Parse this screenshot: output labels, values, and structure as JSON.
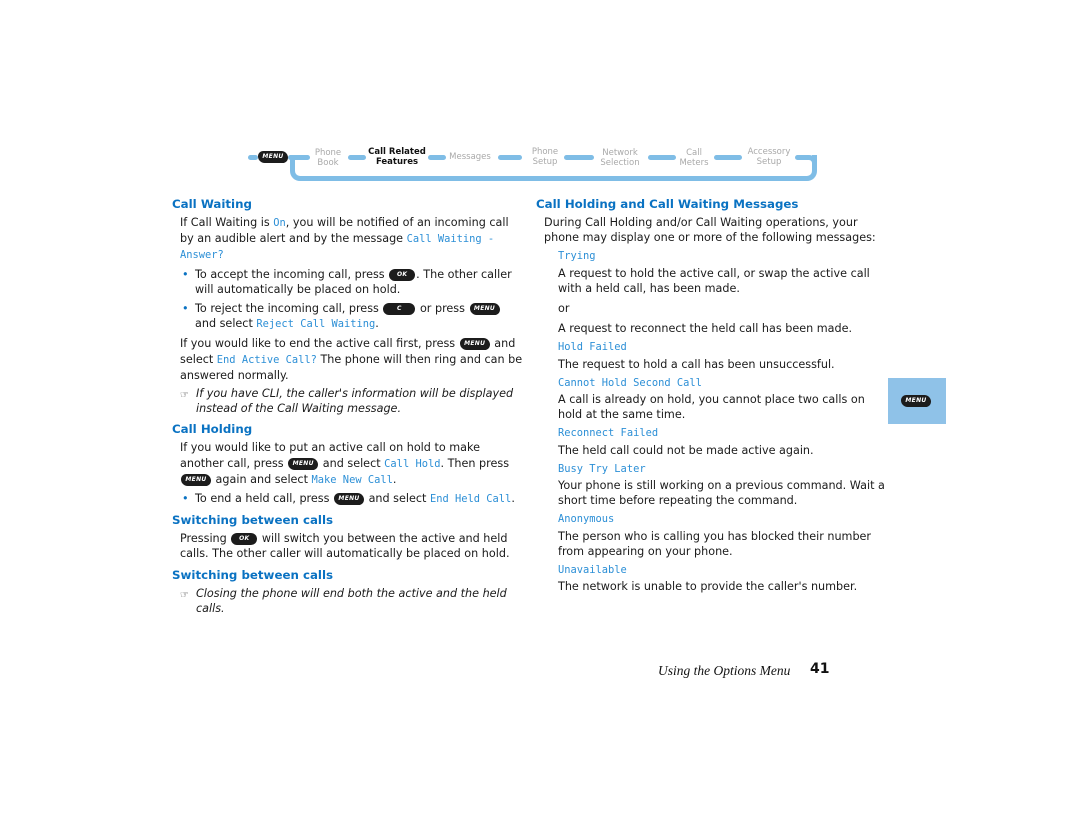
{
  "nav": {
    "menu_key": "MENU",
    "items": [
      {
        "line1": "Phone",
        "line2": "Book",
        "active": false
      },
      {
        "line1": "Call Related",
        "line2": "Features",
        "active": true
      },
      {
        "line1": "Messages",
        "line2": "",
        "active": false
      },
      {
        "line1": "Phone",
        "line2": "Setup",
        "active": false
      },
      {
        "line1": "Network",
        "line2": "Selection",
        "active": false
      },
      {
        "line1": "Call",
        "line2": "Meters",
        "active": false
      },
      {
        "line1": "Accessory",
        "line2": "Setup",
        "active": false
      }
    ]
  },
  "keys": {
    "menu": "MENU",
    "ok": "OK",
    "c": "C"
  },
  "left": {
    "call_waiting": {
      "heading": "Call Waiting",
      "p1_a": "If Call Waiting is ",
      "p1_lcd_on": "On",
      "p1_b": ", you will be notified of an incoming call by an audible alert and by the message ",
      "p1_lcd_msg": "Call Waiting - Answer?",
      "b1_a": "To accept the incoming call, press ",
      "b1_b": ". The other caller will automatically be placed on hold.",
      "b2_a": "To reject the incoming call, press ",
      "b2_b": " or press ",
      "b2_c": " and select ",
      "b2_lcd": "Reject Call Waiting",
      "b2_d": ".",
      "p2_a": "If you would like to end the active call first, press ",
      "p2_b": " and select ",
      "p2_lcd": "End Active Call?",
      "p2_c": " The phone will then ring and can be answered normally.",
      "note": "If you have CLI, the caller's information will be displayed instead of the Call Waiting message."
    },
    "call_holding": {
      "heading": "Call Holding",
      "p1_a": "If you would like to put an active call on hold to make another call, press ",
      "p1_b": " and select ",
      "p1_lcd1": "Call Hold",
      "p1_c": ". Then press ",
      "p1_d": " again and select ",
      "p1_lcd2": "Make New Call",
      "p1_e": ".",
      "b1_a": "To end a held call, press ",
      "b1_b": " and select ",
      "b1_lcd": "End Held Call",
      "b1_c": "."
    },
    "switching1": {
      "heading": "Switching between calls",
      "p_a": "Pressing ",
      "p_b": " will switch you between the active and held calls. The other caller will automatically be placed on hold."
    },
    "switching2": {
      "heading": "Switching between calls",
      "note": "Closing the phone will end both the active and the held calls."
    }
  },
  "right": {
    "heading": "Call Holding and Call Waiting Messages",
    "intro": "During Call Holding and/or Call Waiting operations, your phone may display one or more of the following messages:",
    "messages": [
      {
        "title": "Trying",
        "desc": "A request to hold the active call, or swap the active call with a held call, has been made."
      },
      {
        "title": "",
        "desc": "or"
      },
      {
        "title": "",
        "desc": "A request to reconnect the held call has been made."
      },
      {
        "title": "Hold Failed",
        "desc": "The request to hold a call has been unsuccessful."
      },
      {
        "title": "Cannot Hold Second Call",
        "desc": "A call is already on hold, you cannot place two calls on hold at the same time."
      },
      {
        "title": "Reconnect Failed",
        "desc": "The held call could not be made active again."
      },
      {
        "title": "Busy Try Later",
        "desc": "Your phone is still working on a previous command. Wait a short time before repeating the command."
      },
      {
        "title": "Anonymous",
        "desc": "The person who is calling you has blocked their number from appearing on your phone."
      },
      {
        "title": "Unavailable",
        "desc": "The network is unable to provide the caller's number."
      }
    ]
  },
  "side_tab": {
    "key": "MENU"
  },
  "footer": {
    "title": "Using the Options Menu",
    "page": "41"
  },
  "colors": {
    "accent": "#0a72c2",
    "lcd": "#2c8fd6",
    "nav_line": "#7fbde6",
    "tab": "#8fc2e8"
  }
}
